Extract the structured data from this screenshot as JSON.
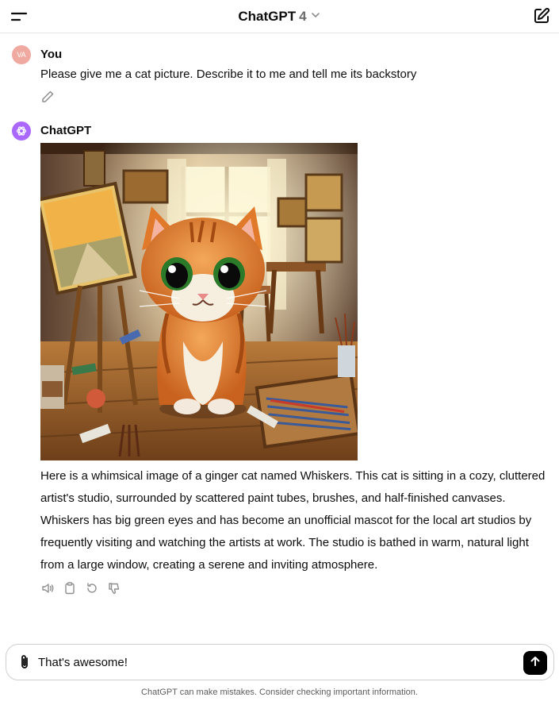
{
  "header": {
    "model_name": "ChatGPT",
    "model_version": "4"
  },
  "user_message": {
    "avatar_initials": "VA",
    "author": "You",
    "text": "Please give me a cat picture. Describe it to me and tell me its backstory"
  },
  "assistant_message": {
    "author": "ChatGPT",
    "text": "Here is a whimsical image of a ginger cat named Whiskers. This cat is sitting in a cozy, cluttered artist's studio, surrounded by scattered paint tubes, brushes, and half-finished canvases. Whiskers has big green eyes and has become an unofficial mascot for the local art studios by frequently visiting and watching the artists at work. The studio is bathed in warm, natural light from a large window, creating a serene and inviting atmosphere."
  },
  "composer": {
    "value": "That's awesome!"
  },
  "footer": {
    "disclaimer": "ChatGPT can make mistakes. Consider checking important information."
  },
  "colors": {
    "user_avatar": "#f0a9a0",
    "assistant_avatar": "#ab68ff",
    "send_button": "#000000",
    "cat_fur": "#e8823a"
  },
  "icons": [
    "menu-icon",
    "chevron-down-icon",
    "new-chat-icon",
    "pencil-icon",
    "openai-logo-icon",
    "speaker-icon",
    "clipboard-icon",
    "regenerate-icon",
    "thumbs-down-icon",
    "paperclip-icon",
    "arrow-up-icon"
  ]
}
